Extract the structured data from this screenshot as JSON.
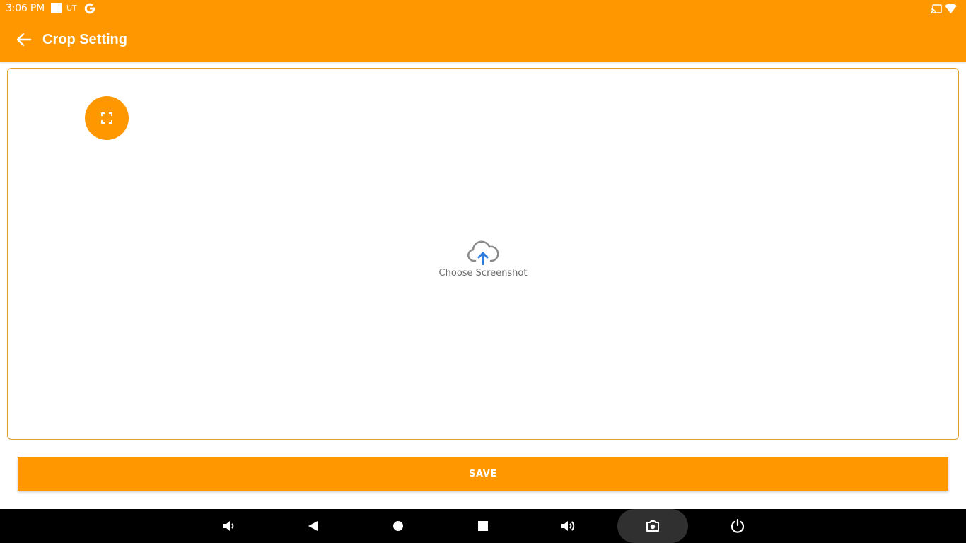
{
  "status_bar": {
    "time": "3:06 PM",
    "carrier_text": "UT",
    "icons": [
      "notification-square-icon",
      "google-g-icon",
      "cast-icon",
      "wifi-icon"
    ]
  },
  "app_bar": {
    "title": "Crop Setting",
    "back_icon": "arrow-left-icon"
  },
  "crop_area": {
    "fullscreen_icon": "fullscreen-icon",
    "upload_icon": "cloud-upload-icon",
    "upload_label": "Choose Screenshot"
  },
  "save_button": {
    "label": "SAVE"
  },
  "nav_bar": {
    "buttons": [
      "volume-down-icon",
      "back-triangle-icon",
      "home-circle-icon",
      "recents-square-icon",
      "volume-up-icon",
      "screenshot-camera-icon",
      "power-icon"
    ]
  },
  "colors": {
    "accent": "#ff9800",
    "border": "#e0a030",
    "upload_arrow": "#2f7de1",
    "upload_cloud": "#8a8a8a",
    "nav_bg": "#000000"
  }
}
